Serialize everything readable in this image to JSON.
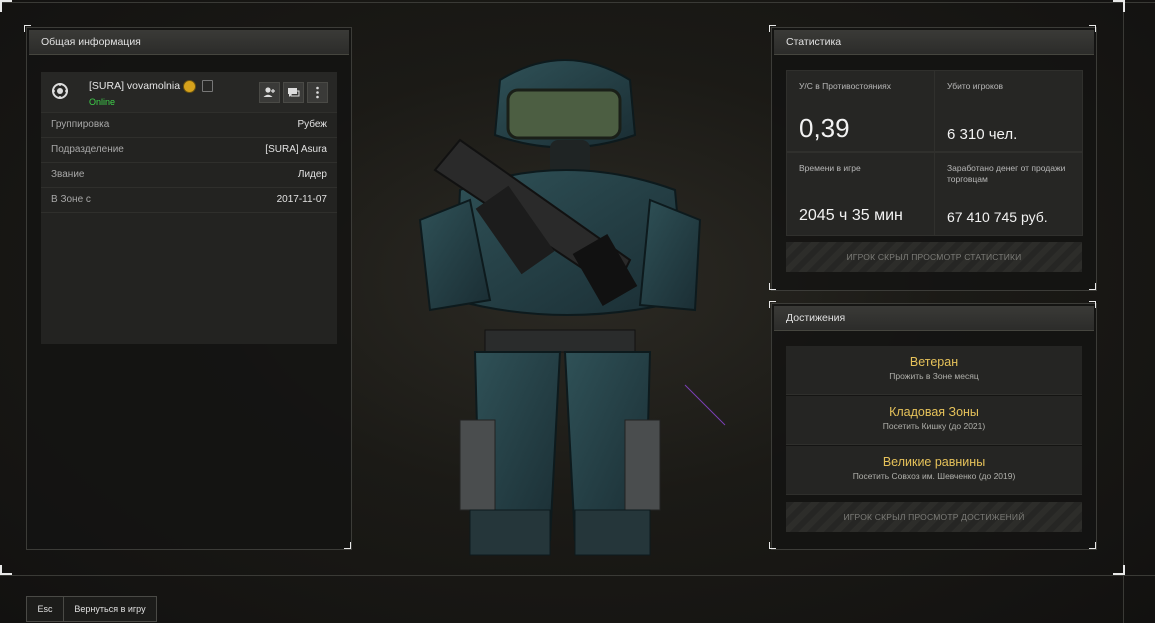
{
  "general_info": {
    "header": "Общая информация",
    "player": {
      "name": "[SURA] vovamolnia",
      "status": "Online"
    },
    "rows": [
      {
        "key": "Группировка",
        "value": "Рубеж"
      },
      {
        "key": "Подразделение",
        "value": "[SURA] Asura"
      },
      {
        "key": "Звание",
        "value": "Лидер"
      },
      {
        "key": "В Зоне с",
        "value": "2017-11-07"
      }
    ]
  },
  "statistics": {
    "header": "Статистика",
    "cells": [
      {
        "label": "У/С в Противостояниях",
        "value": "0,39"
      },
      {
        "label": "Убито игроков",
        "value": "6 310 чел."
      },
      {
        "label": "Времени в игре",
        "value": "2045 ч 35 мин"
      },
      {
        "label": "Заработано денег от продажи торговцам",
        "value": "67 410 745 руб."
      }
    ],
    "hidden_notice": "ИГРОК СКРЫЛ ПРОСМОТР СТАТИСТИКИ"
  },
  "achievements": {
    "header": "Достижения",
    "items": [
      {
        "title": "Ветеран",
        "desc": "Прожить в Зоне месяц"
      },
      {
        "title": "Кладовая Зоны",
        "desc": "Посетить Кишку (до 2021)"
      },
      {
        "title": "Великие равнины",
        "desc": "Посетить Совхоз им. Шевченко (до 2019)"
      }
    ],
    "hidden_notice": "ИГРОК СКРЫЛ ПРОСМОТР ДОСТИЖЕНИЙ"
  },
  "footer": {
    "esc_key": "Esc",
    "back_label": "Вернуться в игру"
  },
  "colors": {
    "online": "#3ed24a",
    "achievement_title": "#e6c25a",
    "badge": "#d6a21c"
  }
}
